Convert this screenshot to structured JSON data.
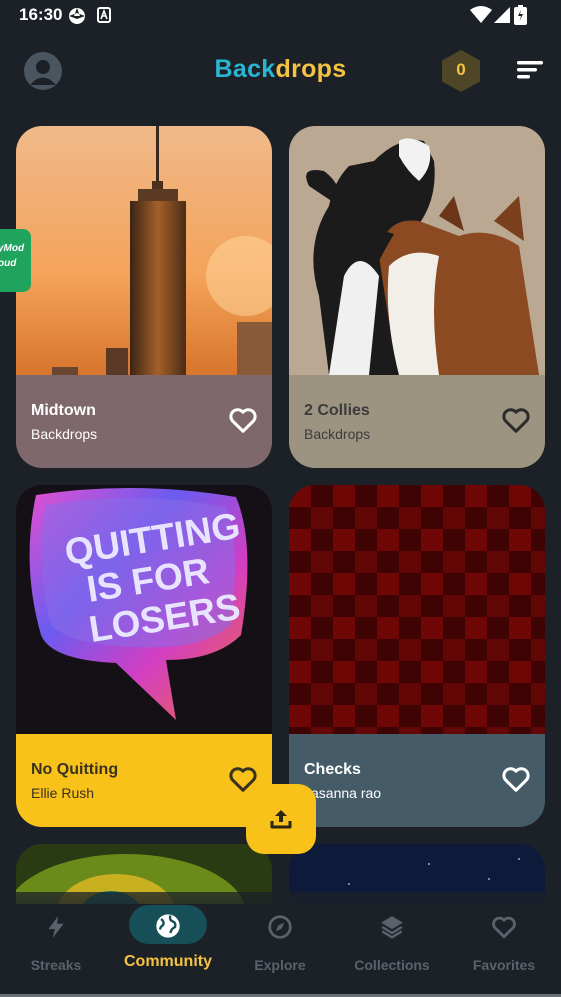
{
  "status_bar": {
    "time": "16:30"
  },
  "header": {
    "title_part1": "Back",
    "title_part2": "drops",
    "coins": "0"
  },
  "overlay_badge": {
    "line1": "yMod",
    "line2": "oud"
  },
  "cards": [
    {
      "title": "Midtown",
      "author": "Backdrops",
      "panel_color": "#7f686c"
    },
    {
      "title": "2 Collies",
      "author": "Backdrops",
      "panel_color": "#9c9480"
    },
    {
      "title": "No Quitting",
      "author": "Ellie Rush",
      "panel_color": "#f8c21a"
    },
    {
      "title": "Checks",
      "author": "Prasanna rao",
      "panel_color": "#465b68"
    }
  ],
  "nav": {
    "items": [
      {
        "label": "Streaks",
        "icon": "lightning-icon"
      },
      {
        "label": "Community",
        "icon": "globe-icon",
        "active": true
      },
      {
        "label": "Explore",
        "icon": "compass-icon"
      },
      {
        "label": "Collections",
        "icon": "layers-icon"
      },
      {
        "label": "Favorites",
        "icon": "heart-icon"
      }
    ]
  },
  "colors": {
    "background": "#1c2127",
    "accent_yellow": "#f5c342",
    "accent_cyan": "#29b6d2",
    "active_pill": "#174f58"
  }
}
